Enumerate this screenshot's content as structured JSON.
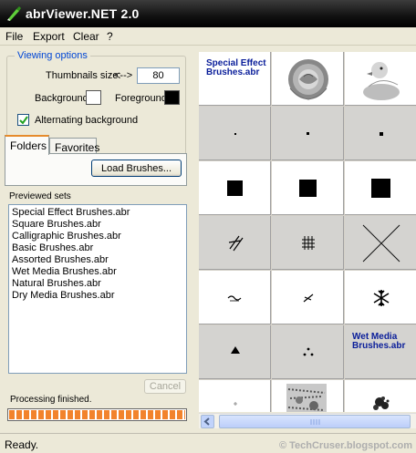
{
  "window": {
    "title": "abrViewer.NET 2.0",
    "icon": "brush-app-icon"
  },
  "menu": [
    "File",
    "Export",
    "Clear",
    "?"
  ],
  "viewing_options": {
    "legend": "Viewing options",
    "thumb_label": "Thumbnails size:",
    "thumb_arrow": "<-->",
    "thumb_value": "80",
    "background_label": "Background:",
    "background_color": "#ffffff",
    "foreground_label": "Foreground:",
    "foreground_color": "#000000",
    "alternating_label": "Alternating background",
    "alternating_checked": true
  },
  "tabs": {
    "folders": "Folders",
    "favorites": "Favorites"
  },
  "load_button": "Load Brushes...",
  "previewed": {
    "label": "Previewed sets",
    "items": [
      "Special Effect Brushes.abr",
      "Square Brushes.abr",
      "Calligraphic Brushes.abr",
      "Basic Brushes.abr",
      "Assorted Brushes.abr",
      "Wet Media Brushes.abr",
      "Natural Brushes.abr",
      "Dry Media Brushes.abr"
    ]
  },
  "cancel_button": "Cancel",
  "processing": {
    "label": "Processing finished.",
    "progress": 1.0
  },
  "thumbnail_labels": {
    "special": "Special Effect Brushes.abr",
    "wet": "Wet Media Brushes.abr"
  },
  "status": "Ready.",
  "watermark": "© TechCruser.blogspot.com"
}
